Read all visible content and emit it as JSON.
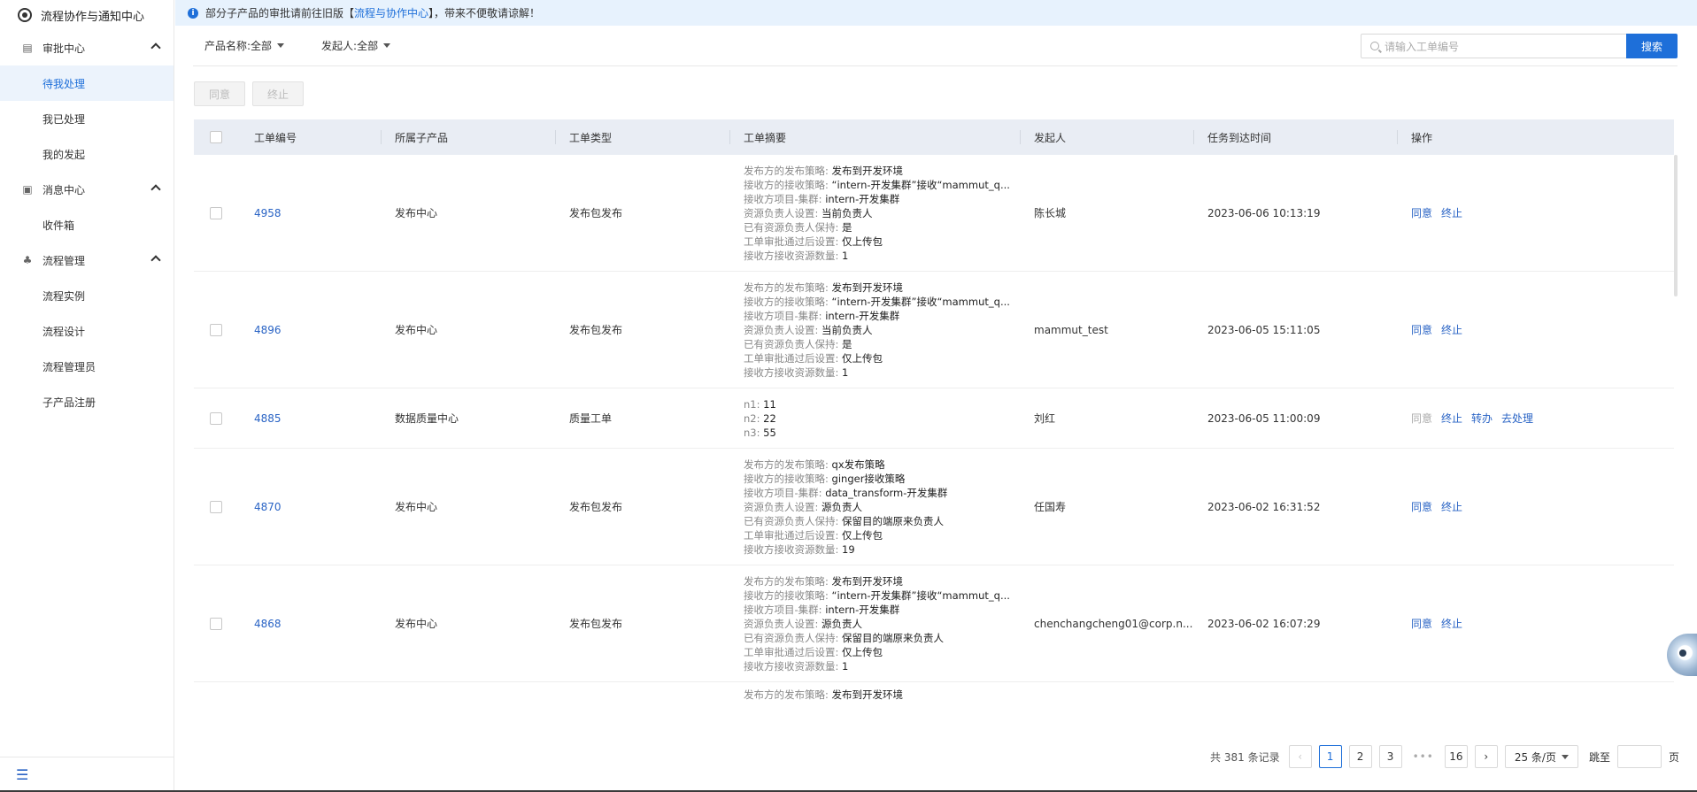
{
  "sidebar": {
    "title": "流程协作与通知中心",
    "groups": [
      {
        "label": "审批中心",
        "items": [
          "待我处理",
          "我已处理",
          "我的发起"
        ]
      },
      {
        "label": "消息中心",
        "items": [
          "收件箱"
        ]
      },
      {
        "label": "流程管理",
        "items": [
          "流程实例",
          "流程设计",
          "流程管理员",
          "子产品注册"
        ]
      }
    ]
  },
  "notice": {
    "prefix": "部分子产品的审批请前往旧版【",
    "link": "流程与协作中心",
    "suffix": "】，带来不便敬请谅解！"
  },
  "filters": {
    "product": "产品名称:全部",
    "initiator": "发起人:全部"
  },
  "search": {
    "placeholder": "请输入工单编号",
    "button": "搜索"
  },
  "actions": {
    "approve": "同意",
    "terminate": "终止"
  },
  "table": {
    "headers": [
      "工单编号",
      "所属子产品",
      "工单类型",
      "工单摘要",
      "发起人",
      "任务到达时间",
      "操作"
    ],
    "rows": [
      {
        "id": "4958",
        "product": "发布中心",
        "type": "发布包发布",
        "summary": [
          [
            "发布方的发布策略:",
            "发布到开发环境"
          ],
          [
            "接收方的接收策略:",
            "“intern-开发集群”接收“mammut_q..."
          ],
          [
            "接收方项目-集群:",
            "intern-开发集群"
          ],
          [
            "资源负责人设置:",
            "当前负责人"
          ],
          [
            "已有资源负责人保持:",
            "是"
          ],
          [
            "工单审批通过后设置:",
            "仅上传包"
          ],
          [
            "接收方接收资源数量:",
            "1"
          ]
        ],
        "initiator": "陈长城",
        "time": "2023-06-06 10:13:19",
        "ops": [
          "同意",
          "终止"
        ]
      },
      {
        "id": "4896",
        "product": "发布中心",
        "type": "发布包发布",
        "summary": [
          [
            "发布方的发布策略:",
            "发布到开发环境"
          ],
          [
            "接收方的接收策略:",
            "“intern-开发集群”接收“mammut_q..."
          ],
          [
            "接收方项目-集群:",
            "intern-开发集群"
          ],
          [
            "资源负责人设置:",
            "当前负责人"
          ],
          [
            "已有资源负责人保持:",
            "是"
          ],
          [
            "工单审批通过后设置:",
            "仅上传包"
          ],
          [
            "接收方接收资源数量:",
            "1"
          ]
        ],
        "initiator": "mammut_test",
        "time": "2023-06-05 15:11:05",
        "ops": [
          "同意",
          "终止"
        ]
      },
      {
        "id": "4885",
        "product": "数据质量中心",
        "type": "质量工单",
        "summary": [
          [
            "n1:",
            "11"
          ],
          [
            "n2:",
            "22"
          ],
          [
            "n3:",
            "55"
          ]
        ],
        "initiator": "刘红",
        "time": "2023-06-05 11:00:09",
        "ops": [
          "同意",
          "终止",
          "转办",
          "去处理"
        ]
      },
      {
        "id": "4870",
        "product": "发布中心",
        "type": "发布包发布",
        "summary": [
          [
            "发布方的发布策略:",
            "qx发布策略"
          ],
          [
            "接收方的接收策略:",
            "ginger接收策略"
          ],
          [
            "接收方项目-集群:",
            "data_transform-开发集群"
          ],
          [
            "资源负责人设置:",
            "源负责人"
          ],
          [
            "已有资源负责人保持:",
            "保留目的端原来负责人"
          ],
          [
            "工单审批通过后设置:",
            "仅上传包"
          ],
          [
            "接收方接收资源数量:",
            "19"
          ]
        ],
        "initiator": "任国寿",
        "time": "2023-06-02 16:31:52",
        "ops": [
          "同意",
          "终止"
        ]
      },
      {
        "id": "4868",
        "product": "发布中心",
        "type": "发布包发布",
        "summary": [
          [
            "发布方的发布策略:",
            "发布到开发环境"
          ],
          [
            "接收方的接收策略:",
            "“intern-开发集群”接收“mammut_q..."
          ],
          [
            "接收方项目-集群:",
            "intern-开发集群"
          ],
          [
            "资源负责人设置:",
            "源负责人"
          ],
          [
            "已有资源负责人保持:",
            "保留目的端原来负责人"
          ],
          [
            "工单审批通过后设置:",
            "仅上传包"
          ],
          [
            "接收方接收资源数量:",
            "1"
          ]
        ],
        "initiator": "chenchangcheng01@corp.n...",
        "time": "2023-06-02 16:07:29",
        "ops": [
          "同意",
          "终止"
        ]
      }
    ],
    "partial_row": [
      "发布方的发布策略:",
      "发布到开发环境"
    ]
  },
  "pagination": {
    "total": "共 381 条记录",
    "pages": [
      "1",
      "2",
      "3",
      "•••",
      "16"
    ],
    "current": "1",
    "page_size": "25 条/页",
    "jump_label": "跳至",
    "jump_suffix": "页"
  },
  "colors": {
    "accent": "#1e6fd9",
    "link": "#2a64c5",
    "notice_bg": "#e7f2fd",
    "header_bg": "#e9edf4",
    "active_bg": "#ecf3fc"
  }
}
